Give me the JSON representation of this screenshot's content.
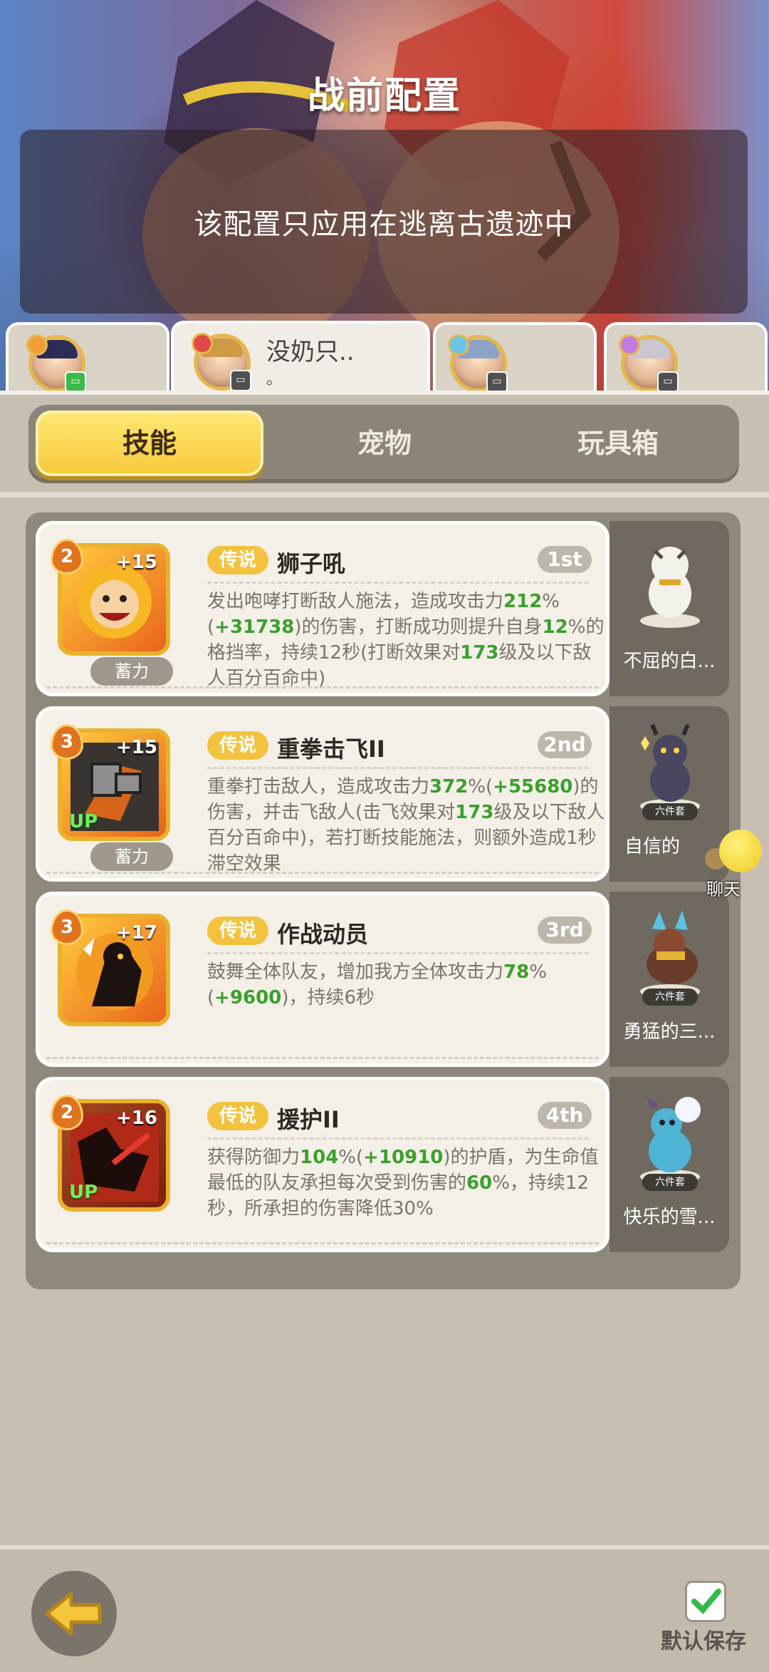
{
  "header": {
    "title": "战前配置",
    "notice": "该配置只应用在逃离古遗迹中"
  },
  "hero_tabs": [
    {
      "name": "",
      "sub": "",
      "active": false
    },
    {
      "name": "没奶只..",
      "sub": "。",
      "active": true
    },
    {
      "name": "",
      "sub": "",
      "active": false
    },
    {
      "name": "",
      "sub": "",
      "active": false
    }
  ],
  "tabs": [
    "技能",
    "宠物",
    "玩具箱"
  ],
  "active_tab": "技能",
  "skills": [
    {
      "level": "2",
      "plus": "+15",
      "up": "",
      "charge": "蓄力",
      "rarity": "传说",
      "name": "狮子吼",
      "rank": "1st",
      "desc_parts": [
        {
          "t": "发出咆哮打断敌人施法，造成攻击力"
        },
        {
          "t": "212",
          "g": true
        },
        {
          "t": "%("
        },
        {
          "t": "+31738",
          "g": true
        },
        {
          "t": ")的伤害，打断成功则提升自身"
        },
        {
          "t": "12",
          "g": true
        },
        {
          "t": "%的格挡率，持续12秒(打断效果对"
        },
        {
          "t": "173",
          "g": true
        },
        {
          "t": "级及以下敌人百分百命中)"
        }
      ],
      "pet": {
        "name": "不屈的白...",
        "set": ""
      }
    },
    {
      "level": "3",
      "plus": "+15",
      "up": "UP",
      "charge": "蓄力",
      "rarity": "传说",
      "name": "重拳击飞II",
      "rank": "2nd",
      "desc_parts": [
        {
          "t": "重拳打击敌人，造成攻击力"
        },
        {
          "t": "372",
          "g": true
        },
        {
          "t": "%("
        },
        {
          "t": "+55680",
          "g": true
        },
        {
          "t": ")的伤害，并击飞敌人(击飞效果对"
        },
        {
          "t": "173",
          "g": true
        },
        {
          "t": "级及以下敌人百分百命中)，若打断技能施法，则额外造成1秒滞空效果"
        }
      ],
      "pet": {
        "name": "自信的",
        "set": "六件套"
      }
    },
    {
      "level": "3",
      "plus": "+17",
      "up": "",
      "charge": "",
      "rarity": "传说",
      "name": "作战动员",
      "rank": "3rd",
      "desc_parts": [
        {
          "t": "鼓舞全体队友，增加我方全体攻击力"
        },
        {
          "t": "78",
          "g": true
        },
        {
          "t": "%("
        },
        {
          "t": "+9600",
          "g": true
        },
        {
          "t": ")，持续6秒"
        }
      ],
      "pet": {
        "name": "勇猛的三...",
        "set": "六件套"
      }
    },
    {
      "level": "2",
      "plus": "+16",
      "up": "UP",
      "charge": "",
      "rarity": "传说",
      "name": "援护II",
      "rank": "4th",
      "desc_parts": [
        {
          "t": "获得防御力"
        },
        {
          "t": "104",
          "g": true
        },
        {
          "t": "%("
        },
        {
          "t": "+10910",
          "g": true
        },
        {
          "t": ")的护盾，为生命值最低的队友承担每次受到伤害的"
        },
        {
          "t": "60",
          "g": true
        },
        {
          "t": "%，持续12秒，所承担的伤害降低30%"
        }
      ],
      "pet": {
        "name": "快乐的雪...",
        "set": "六件套"
      }
    }
  ],
  "chat_label": "聊天",
  "save_label": "默认保存",
  "colors": {
    "gold": "#f3c23e",
    "green_value": "#3aa02c",
    "panel": "#8f887c"
  }
}
